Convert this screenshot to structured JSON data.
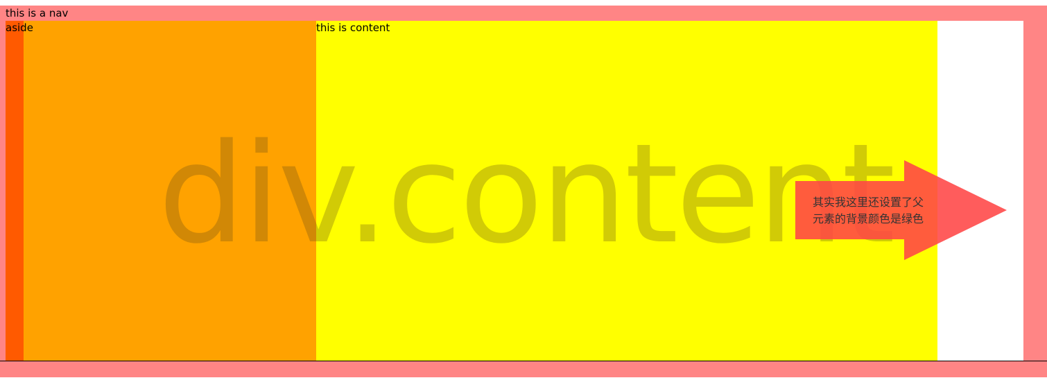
{
  "nav": {
    "text": "this is a nav"
  },
  "aside": {
    "text": "aside"
  },
  "content": {
    "text": "this is content"
  },
  "watermark": {
    "text": "div.content"
  },
  "callout": {
    "line1": "其实我这里还设置了父",
    "line2": "元素的背景颜色是绿色"
  },
  "colors": {
    "frame": "#ff8585",
    "aside": "#ffa200",
    "aside_strip": "#ff5a00",
    "content": "#ffff00",
    "arrow": "#ff5a4a",
    "page": "#ffffff"
  }
}
